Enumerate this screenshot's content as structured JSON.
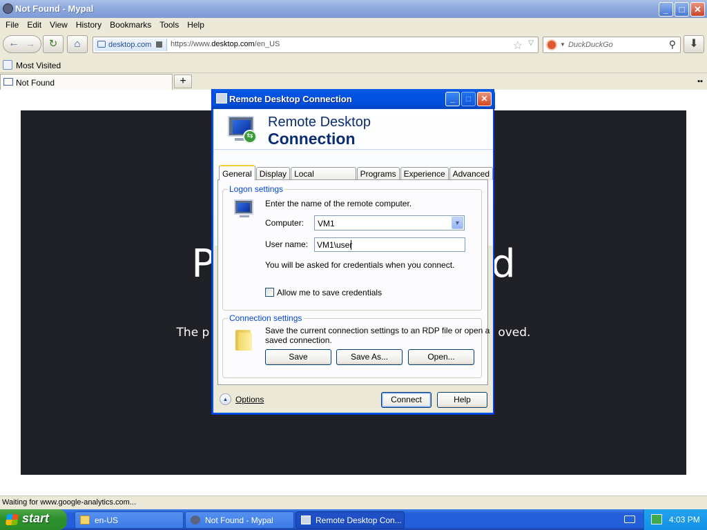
{
  "browser": {
    "title": "Not Found - Mypal",
    "window_buttons": {
      "minimize": "_",
      "maximize": "□",
      "close": "✕"
    },
    "menu": [
      "File",
      "Edit",
      "View",
      "History",
      "Bookmarks",
      "Tools",
      "Help"
    ],
    "nav": {
      "back": "←",
      "forward": "→",
      "reload": "↻",
      "home": "⌂",
      "star": "☆",
      "dropdown": "▽",
      "search_icon": "⚲",
      "download": "⬇"
    },
    "identity": "desktop.com",
    "url_prefix": "https://www.",
    "url_host": "desktop.com",
    "url_path": "/en_US",
    "search_placeholder": "DuckDuckGo",
    "bookmark": "Most Visited",
    "tab_title": "Not Found",
    "new_tab": "+",
    "tab_list": "▪▪",
    "page_heading_left": "P",
    "page_heading_right": "d",
    "page_sub_left": "The p",
    "page_sub_right": "oved.",
    "status": "Waiting for www.google-analytics.com..."
  },
  "taskbar": {
    "start": "start",
    "tasks": [
      "en-US",
      "Not Found - Mypal",
      "Remote Desktop Con..."
    ],
    "clock": "4:03 PM"
  },
  "rdp": {
    "title": "Remote Desktop Connection",
    "banner_line1": "Remote Desktop",
    "banner_line2": "Connection",
    "tabs": [
      "General",
      "Display",
      "Local Resources",
      "Programs",
      "Experience",
      "Advanced"
    ],
    "logon_title": "Logon settings",
    "logon_hint": "Enter the name of the remote computer.",
    "computer_label": "Computer:",
    "computer_value": "VM1",
    "user_label": "User name:",
    "user_value": "VM1\\user",
    "credentials_note": "You will be asked for credentials when you connect.",
    "save_creds_label": "Allow me to save credentials",
    "save_creds_checked": false,
    "conn_title": "Connection settings",
    "conn_text_1": "Save the current connection settings to an RDP file or open a",
    "conn_text_2": "saved connection.",
    "btn_save": "Save",
    "btn_save_as": "Save As...",
    "btn_open": "Open...",
    "options": "Options",
    "btn_connect": "Connect",
    "btn_help": "Help"
  }
}
